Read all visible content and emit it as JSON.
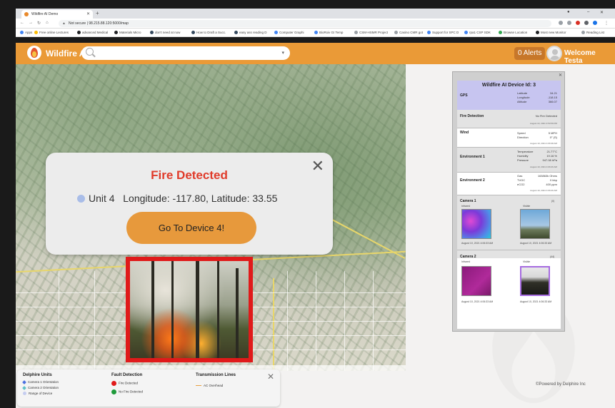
{
  "browser": {
    "tab_title": "Wildfire AI Demo",
    "url": "Not secure | 98.215.88.120:5000/map",
    "bookmarks": [
      "Apps",
      "Free online Lectures",
      "advanced Medical",
      "Materials Micro",
      "don't need at now",
      "How to Draft a Succ.",
      "easy ass reading D",
      "Computer Graphi",
      "BioRxiv GI Temp",
      "CSM-HSMR Project",
      "Casino CMR got",
      "Support for SPC D",
      "rpa1 CSP SDK",
      "Browse Location",
      "Most new Monitor",
      "Reading List"
    ]
  },
  "header": {
    "app_title": "Wildfire AI",
    "search_placeholder": "",
    "alerts_label": "0 Alerts",
    "welcome_text": "Welcome Testa"
  },
  "popup": {
    "title": "Fire Detected",
    "unit_label": "Unit 4",
    "coords_text": "Longitude: -117.80, Latitude: 33.55",
    "button_label": "Go To Device 4!",
    "close_symbol": "✕"
  },
  "legend": {
    "units_title": "Delphire Units",
    "units_items": [
      "Camera 1 Orientation",
      "Camera 2 Orientation",
      "Range of Device"
    ],
    "fault_title": "Fault Detection",
    "fault_items": [
      "Fire Detected",
      "No Fire Detected"
    ],
    "tx_title": "Transmission Lines",
    "tx_items": [
      "AC Overhead"
    ],
    "colors": {
      "fire": "#e01a1a",
      "nofire": "#1e9a3a",
      "camera1": "#4a6ee0",
      "camera2": "#5fc1c8",
      "line": "#e8a040"
    }
  },
  "footer": {
    "powered_by": "©Powered by Delphire Inc"
  },
  "device": {
    "title": "Wildfire AI Device Id: 3",
    "gps_label": "GPS",
    "gps": [
      {
        "key": "Latitude",
        "value": "34.21"
      },
      {
        "key": "Longitude",
        "value": "-118.15"
      },
      {
        "key": "Altitude",
        "value": "366.07"
      }
    ],
    "fire_label": "Fire Detection",
    "fire_value": "No Fire Detected",
    "fire_time": "August 10, 2021 3:53:59 PM",
    "wind_label": "Wind",
    "wind": [
      {
        "key": "Speed",
        "value": "5 MPH"
      },
      {
        "key": "Direction",
        "value": "0° (S)"
      }
    ],
    "wind_time": "August 10, 2021 4:06:38 AM",
    "env1_label": "Environment 1",
    "env1": [
      {
        "key": "Temperature",
        "value": "21.77°C"
      },
      {
        "key": "Humidity",
        "value": "19.16 %"
      },
      {
        "key": "Pressure",
        "value": "947.08 hPa"
      }
    ],
    "env1_time": "August 10, 2021 4:06:26 AM",
    "env2_label": "Environment 2",
    "env2": [
      {
        "key": "Gas",
        "value": "163863k Ohms"
      },
      {
        "key": "TVOC",
        "value": "0 bbp"
      },
      {
        "key": "eCO2",
        "value": "400 ppm"
      }
    ],
    "env2_time": "August 10, 2021 4:06:26 AM",
    "camera1_label": "Camera 1",
    "camera1_angle": "(0)",
    "camera2_label": "Camera 2",
    "camera2_angle": "(44)",
    "infrared_label": "Infrared",
    "visible_label": "Visible",
    "cam1_ir_time": "August 10, 2021 4:06:33 AM",
    "cam1_vis_time": "August 10, 2021 4:06:33 AM",
    "cam2_ir_time": "August 10, 2021 4:06:33 AM",
    "cam2_vis_time": "August 10, 2021 4:06:33 AM"
  }
}
